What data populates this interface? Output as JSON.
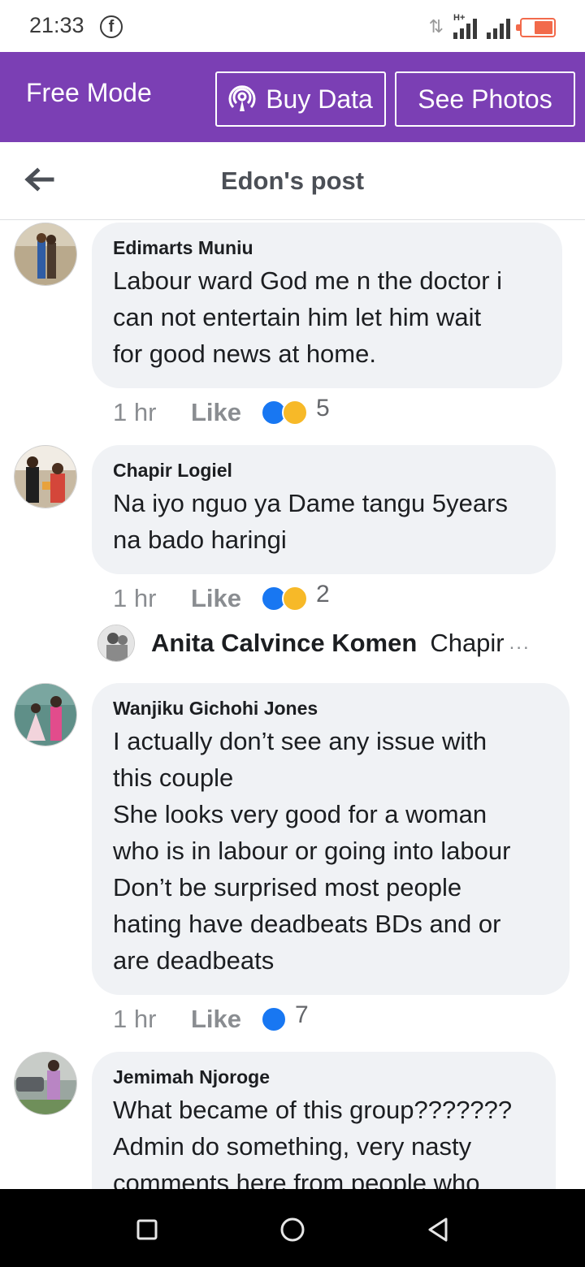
{
  "status_bar": {
    "time": "21:33",
    "facebook_badge": "f",
    "network_type": "H+"
  },
  "free_bar": {
    "mode_label": "Free Mode",
    "buy_data_label": "Buy Data",
    "see_photos_label": "See Photos"
  },
  "header": {
    "title": "Edon's post"
  },
  "comments": [
    {
      "author": "Edimarts Muniu",
      "text": "Labour ward God  me n the doctor i\ncan not entertain him let him wait\nfor good news at home.",
      "time": "1 hr",
      "like_label": "Like",
      "reactions": [
        "like",
        "haha"
      ],
      "reaction_count": "5"
    },
    {
      "author": "Chapir Logiel",
      "text": "Na iyo nguo ya Dame tangu 5years\nna bado haringi",
      "time": "1 hr",
      "like_label": "Like",
      "reactions": [
        "like",
        "sad"
      ],
      "reaction_count": "2"
    },
    {
      "author": "Wanjiku Gichohi Jones",
      "text": "I actually don’t see any issue with\nthis couple\nShe looks very good for a woman\nwho is in labour or going into labour\nDon’t be surprised most people\nhating have deadbeats BDs and or\nare deadbeats",
      "time": "1 hr",
      "like_label": "Like",
      "reactions": [
        "like"
      ],
      "reaction_count": "7"
    },
    {
      "author": "Jemimah Njoroge",
      "text": "What became of this group???????\nAdmin do something, very nasty\ncomments here from people who"
    }
  ],
  "reply_preview": {
    "author": "Anita Calvince Komen",
    "snippet": "Chapir",
    "more": "..."
  },
  "colors": {
    "purple_bar": "#7b3fb4",
    "bubble_bg": "#f0f2f5",
    "like_blue": "#1877f2",
    "emoji_yellow": "#f7b928"
  }
}
